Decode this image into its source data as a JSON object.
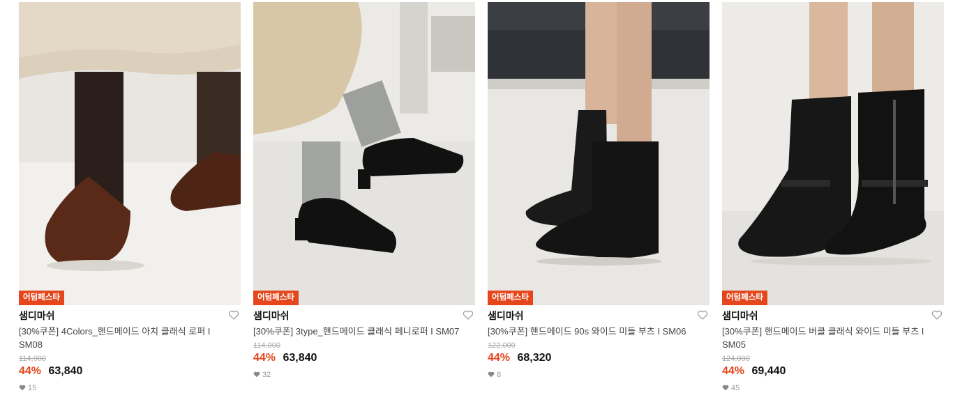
{
  "colors": {
    "accent": "#e5461b",
    "badge_bg": "#e5461b",
    "strike": "#aaaaaa"
  },
  "products": [
    {
      "badge": "어텀페스타",
      "brand": "샘디마쉬",
      "title": "[30%쿠폰] 4Colors_핸드메이드 아치 클래식 로퍼 I SM08",
      "original_price": "114,000",
      "discount": "44%",
      "price": "63,840",
      "likes": "15",
      "image_desc": "brown croc loafers with ribbed socks",
      "icon": "heart-outline-icon"
    },
    {
      "badge": "어텀페스타",
      "brand": "샘디마쉬",
      "title": "[30%쿠폰] 3type_핸드메이드 클래식 페니로퍼 I SM07",
      "original_price": "114,000",
      "discount": "44%",
      "price": "63,840",
      "likes": "32",
      "image_desc": "black patent heeled penny loafers",
      "icon": "heart-outline-icon"
    },
    {
      "badge": "어텀페스타",
      "brand": "샘디마쉬",
      "title": "[30%쿠폰] 핸드메이드 90s 와이드 미들 부츠 I SM06",
      "original_price": "122,000",
      "discount": "44%",
      "price": "68,320",
      "likes": "8",
      "image_desc": "black wide mid boots",
      "icon": "heart-outline-icon"
    },
    {
      "badge": "어텀페스타",
      "brand": "샘디마쉬",
      "title": "[30%쿠폰] 핸드메이드 버클 클래식 와이드 미들 부츠 I SM05",
      "original_price": "124,000",
      "discount": "44%",
      "price": "69,440",
      "likes": "45",
      "image_desc": "black buckle mid boots",
      "icon": "heart-outline-icon"
    }
  ]
}
